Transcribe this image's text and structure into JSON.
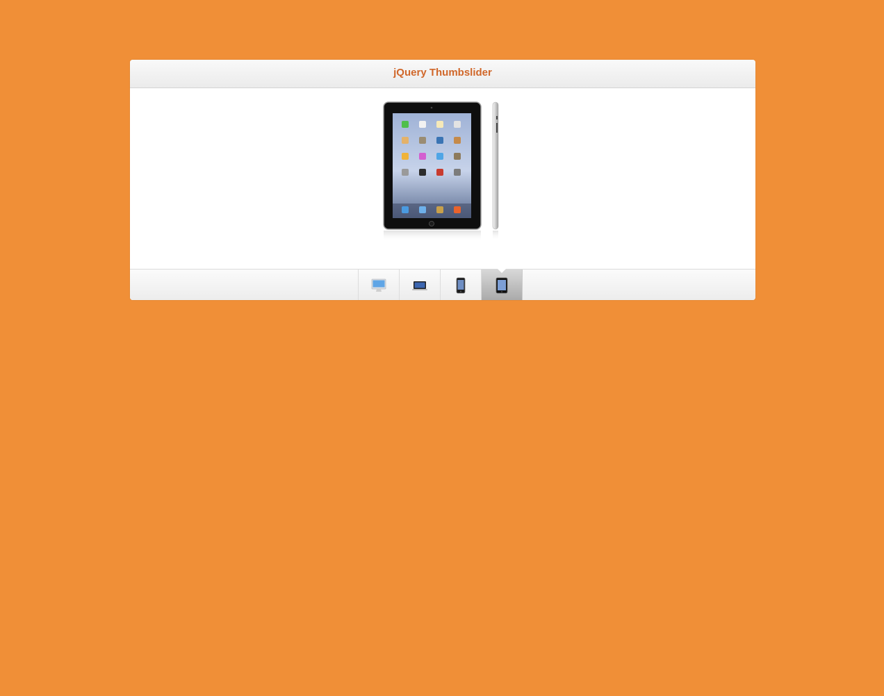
{
  "colors": {
    "page_background": "#f08f37",
    "title_color": "#d0672a",
    "panel_background": "#ffffff"
  },
  "header": {
    "title": "jQuery Thumbslider"
  },
  "slider": {
    "active_index": 3,
    "main_image_icon": "ipad-front-and-side-image",
    "thumbnails": [
      {
        "icon": "imac-icon"
      },
      {
        "icon": "macbook-icon"
      },
      {
        "icon": "iphone-icon"
      },
      {
        "icon": "ipad-icon"
      }
    ]
  }
}
